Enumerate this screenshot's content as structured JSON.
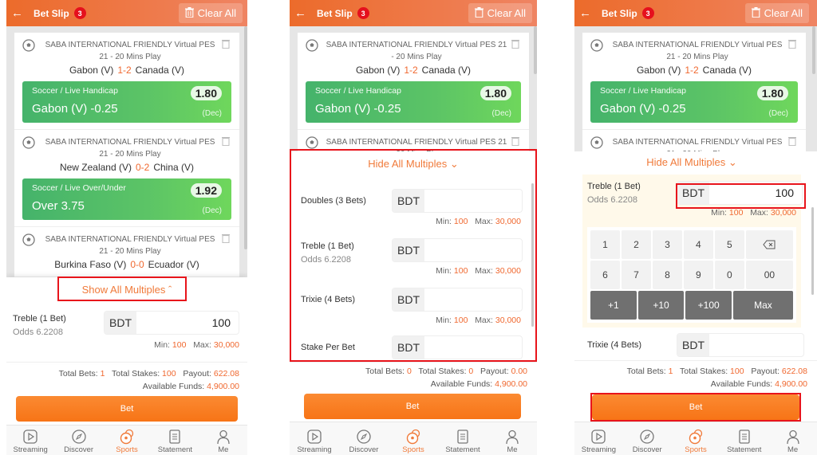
{
  "header": {
    "back_icon": "arrow-left-icon",
    "title": "Bet Slip",
    "badge_count": "3",
    "clear_all_label": "Clear All",
    "clear_icon": "trash-icon"
  },
  "bets": [
    {
      "league": "SABA INTERNATIONAL FRIENDLY Virtual PES 21 - 20 Mins Play",
      "home": "Gabon (V)",
      "score": "1-2",
      "away": "Canada (V)",
      "market": "Soccer / Live Handicap",
      "pick": "Gabon (V)  -0.25",
      "odds": "1.80",
      "odds_format": "(Dec)"
    },
    {
      "league": "SABA INTERNATIONAL FRIENDLY Virtual PES 21 - 20 Mins Play",
      "home": "New Zealand (V)",
      "score": "0-2",
      "away": "China (V)",
      "market": "Soccer / Live Over/Under",
      "pick": "Over  3.75",
      "odds": "1.92",
      "odds_format": "(Dec)"
    },
    {
      "league": "SABA INTERNATIONAL FRIENDLY Virtual PES 21 - 20 Mins Play",
      "home": "Burkina Faso (V)",
      "score": "0-0",
      "away": "Ecuador (V)"
    }
  ],
  "multiples": {
    "show_label": "Show All Multiples",
    "hide_label": "Hide All Multiples",
    "currency": "BDT",
    "min_label": "Min:",
    "min_value": "100",
    "max_label": "Max:",
    "max_value": "30,000",
    "odds_label": "Odds",
    "rows": [
      {
        "label": "Doubles (3 Bets)"
      },
      {
        "label": "Treble (1 Bet)",
        "odds": "6.2208"
      },
      {
        "label": "Trixie (4 Bets)"
      },
      {
        "label": "Stake Per Bet"
      }
    ]
  },
  "panel1": {
    "treble_stake": "100",
    "total_bets": "1",
    "total_stakes": "100",
    "payout": "622.08",
    "available_funds": "4,900.00"
  },
  "panel2": {
    "total_bets": "0",
    "total_stakes": "0",
    "payout": "0.00",
    "available_funds": "4,900.00"
  },
  "panel3": {
    "treble_stake": "100",
    "total_bets": "1",
    "total_stakes": "100",
    "payout": "622.08",
    "available_funds": "4,900.00"
  },
  "totals_labels": {
    "total_bets": "Total Bets:",
    "total_stakes": "Total Stakes:",
    "payout": "Payout:",
    "available_funds": "Available Funds:"
  },
  "keypad": {
    "digits_row1": [
      "1",
      "2",
      "3",
      "4",
      "5"
    ],
    "digits_row2": [
      "6",
      "7",
      "8",
      "9",
      "0"
    ],
    "backspace_icon": "backspace-icon",
    "double_zero": "00",
    "quick": [
      "+1",
      "+10",
      "+100",
      "Max"
    ]
  },
  "bet_button_label": "Bet",
  "tabs": [
    {
      "label": "Streaming",
      "icon": "play-icon"
    },
    {
      "label": "Discover",
      "icon": "compass-icon"
    },
    {
      "label": "Sports",
      "icon": "sports-balls-icon",
      "active": true
    },
    {
      "label": "Statement",
      "icon": "document-list-icon"
    },
    {
      "label": "Me",
      "icon": "user-icon"
    }
  ],
  "colors": {
    "brand_orange": "#ef6f2e",
    "accent_text": "#f0682f",
    "selection_green": "#52bb68",
    "highlight_red": "#e8141b",
    "badge_red": "#e5101d"
  }
}
